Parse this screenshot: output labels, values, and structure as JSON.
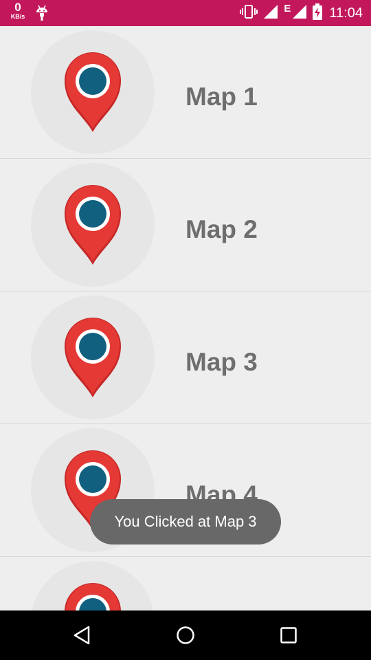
{
  "status_bar": {
    "net_speed_value": "0",
    "net_speed_unit": "KB/s",
    "network_type": "E",
    "time": "11:04",
    "icons": [
      "android-icon",
      "vibrate-icon",
      "signal-icon",
      "signal-icon",
      "battery-charging-icon"
    ],
    "color": "#c2185b"
  },
  "list": {
    "items": [
      {
        "label": "Map 1",
        "icon": "map-pin-icon"
      },
      {
        "label": "Map 2",
        "icon": "map-pin-icon"
      },
      {
        "label": "Map 3",
        "icon": "map-pin-icon"
      },
      {
        "label": "Map 4",
        "icon": "map-pin-icon"
      },
      {
        "label": "",
        "icon": "map-pin-icon"
      }
    ]
  },
  "toast": {
    "message": "You Clicked at Map 3"
  },
  "nav_bar": {
    "buttons": [
      "back-icon",
      "home-icon",
      "recents-icon"
    ]
  },
  "colors": {
    "pin_red": "#e53935",
    "pin_dark_red": "#c62828",
    "pin_center": "#11607f",
    "label_gray": "#6e6e6e"
  }
}
